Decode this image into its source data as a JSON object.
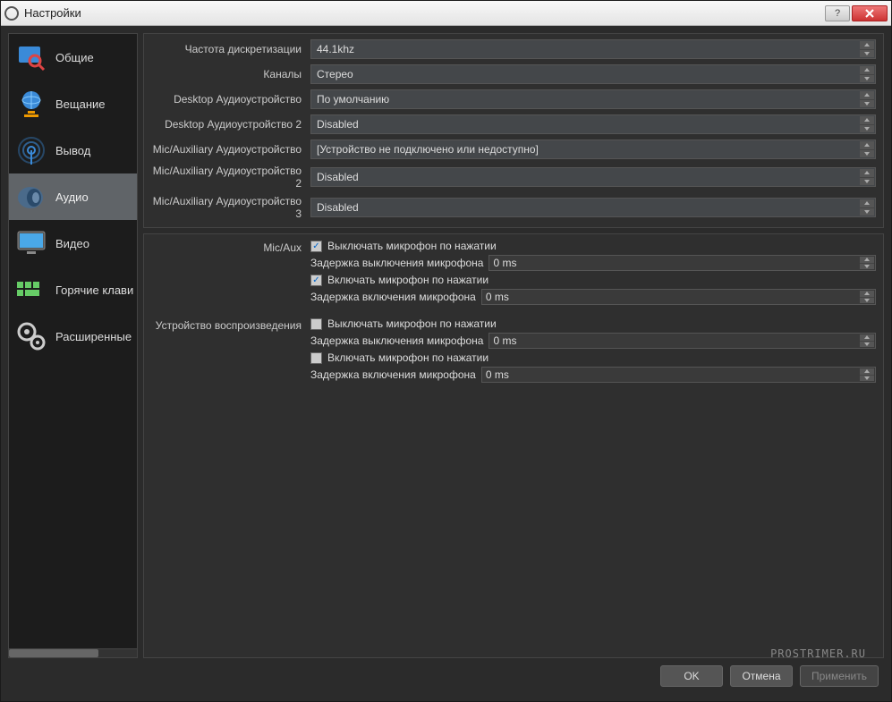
{
  "window": {
    "title": "Настройки"
  },
  "sidebar": {
    "items": [
      {
        "id": "general",
        "label": "Общие"
      },
      {
        "id": "stream",
        "label": "Вещание"
      },
      {
        "id": "output",
        "label": "Вывод"
      },
      {
        "id": "audio",
        "label": "Аудио"
      },
      {
        "id": "video",
        "label": "Видео"
      },
      {
        "id": "hotkeys",
        "label": "Горячие клави"
      },
      {
        "id": "advanced",
        "label": "Расширенные"
      }
    ],
    "active": "audio"
  },
  "audio": {
    "rows": [
      {
        "label": "Частота дискретизации",
        "value": "44.1khz"
      },
      {
        "label": "Каналы",
        "value": "Стерео"
      },
      {
        "label": "Desktop Аудиоустройство",
        "value": "По умолчанию"
      },
      {
        "label": "Desktop Аудиоустройство 2",
        "value": "Disabled"
      },
      {
        "label": "Mic/Auxiliary Аудиоустройство",
        "value": "[Устройство не подключено или недоступно]"
      },
      {
        "label": "Mic/Auxiliary Аудиоустройство 2",
        "value": "Disabled"
      },
      {
        "label": "Mic/Auxiliary Аудиоустройство 3",
        "value": "Disabled"
      }
    ],
    "sections": [
      {
        "label": "Mic/Aux",
        "ptt_off_label": "Выключать микрофон по нажатии",
        "ptt_off_checked": true,
        "ptt_off_delay_label": "Задержка выключения микрофона",
        "ptt_off_delay_value": "0 ms",
        "ptt_on_label": "Включать микрофон по нажатии",
        "ptt_on_checked": true,
        "ptt_on_delay_label": "Задержка включения микрофона",
        "ptt_on_delay_value": "0 ms"
      },
      {
        "label": "Устройство воспроизведения",
        "ptt_off_label": "Выключать микрофон по нажатии",
        "ptt_off_checked": false,
        "ptt_off_delay_label": "Задержка выключения микрофона",
        "ptt_off_delay_value": "0 ms",
        "ptt_on_label": "Включать микрофон по нажатии",
        "ptt_on_checked": false,
        "ptt_on_delay_label": "Задержка включения микрофона",
        "ptt_on_delay_value": "0 ms"
      }
    ]
  },
  "footer": {
    "ok": "OK",
    "cancel": "Отмена",
    "apply": "Применить"
  },
  "watermark": "PROSTRIMER.RU"
}
